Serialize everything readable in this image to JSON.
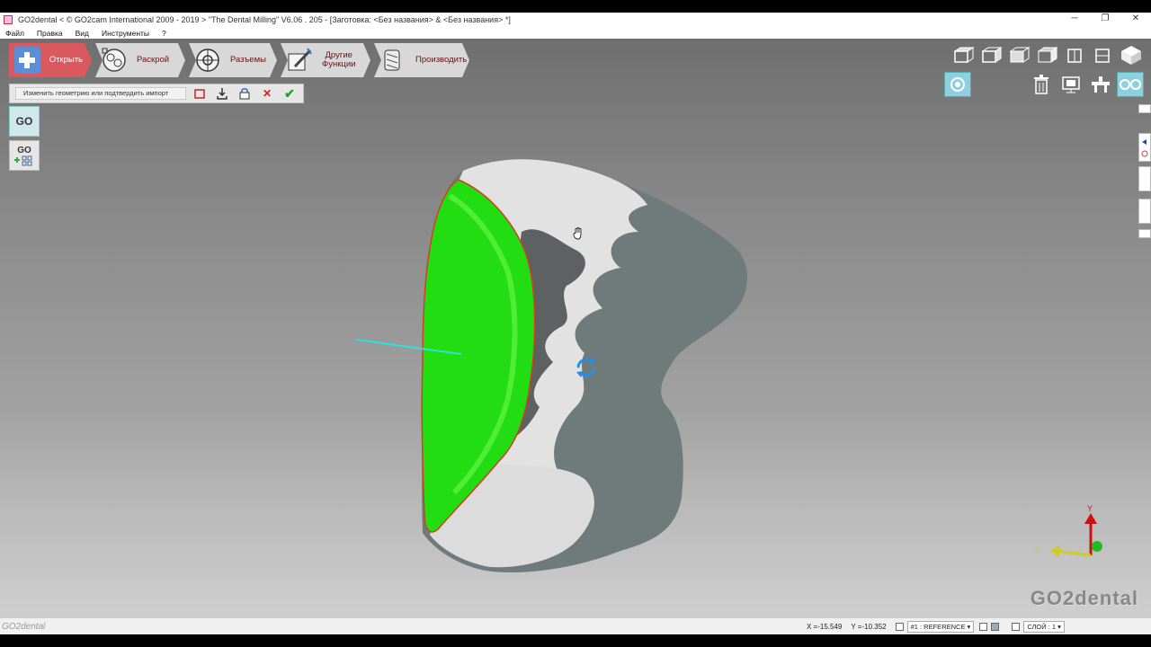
{
  "window": {
    "title": "GO2dental < © GO2cam International 2009 - 2019 >    \"The Dental Milling\"   V6.06 . 205 - [Заготовка: <Без названия> & <Без названия> *]",
    "minimize": "─",
    "maximize": "❐",
    "close": "✕"
  },
  "menu": [
    "Файл",
    "Правка",
    "Вид",
    "Инструменты",
    "?"
  ],
  "workflow": [
    {
      "label": "Открыть",
      "active": true
    },
    {
      "label": "Раскрой",
      "active": false
    },
    {
      "label": "Разъемы",
      "active": false
    },
    {
      "label": "Другие\nФункции",
      "active": false
    },
    {
      "label": "Производить",
      "active": false
    }
  ],
  "command_bar": {
    "prompt": "Изменить геометрию или подтвердить импорт",
    "buttons": [
      "select-box-icon",
      "import-icon",
      "lock-icon",
      "cancel-icon",
      "confirm-icon"
    ]
  },
  "left_buttons": {
    "go": "GO",
    "go_plus": "GO"
  },
  "axes": {
    "y": "Y",
    "z": "Z"
  },
  "brand": "GO2dental",
  "status": {
    "app": "GO2dental",
    "x": "X =-15.549",
    "y": "Y =-10.352",
    "reference": "#1 : REFERENCE",
    "layer": "СЛОЙ : 1"
  },
  "colors": {
    "accent": "#d9595f",
    "model_surface": "#6f7b7b",
    "model_highlight": "#e2e2e2",
    "selected_surface": "#22dd11"
  }
}
